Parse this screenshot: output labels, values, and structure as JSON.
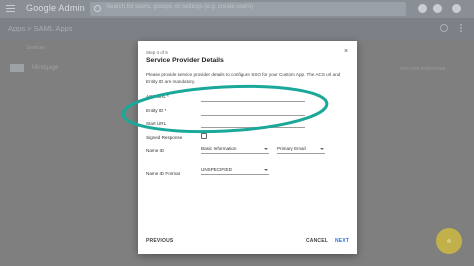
{
  "header": {
    "brand": "Google Admin",
    "search_placeholder": "Search for users, groups, or settings (e.g. create users)"
  },
  "breadcrumb": "Apps  >  SAML Apps",
  "background": {
    "services_label": "Services",
    "app_name": "Mindgage",
    "app_status": "OFF FOR EVERYONE"
  },
  "dialog": {
    "step": "Step 4 of 5",
    "title": "Service Provider Details",
    "description": "Please provide service provider details to configure SSO for your Custom App. The ACS url and Entity ID are mandatory.",
    "fields": {
      "acs_url_label": "ACS URL *",
      "entity_id_label": "Entity ID *",
      "start_url_label": "Start URL",
      "signed_response_label": "Signed Response",
      "name_id_label": "Name ID",
      "name_id_value": "Basic Information",
      "name_id_attr_value": "Primary Email",
      "name_id_format_label": "Name ID Format",
      "name_id_format_value": "UNSPECIFIED"
    },
    "buttons": {
      "previous": "PREVIOUS",
      "cancel": "CANCEL",
      "next": "NEXT"
    },
    "close_glyph": "×"
  },
  "colors": {
    "annotation": "#1aa89a",
    "next_button": "#2b73d6",
    "fab": "#c2b04a"
  }
}
